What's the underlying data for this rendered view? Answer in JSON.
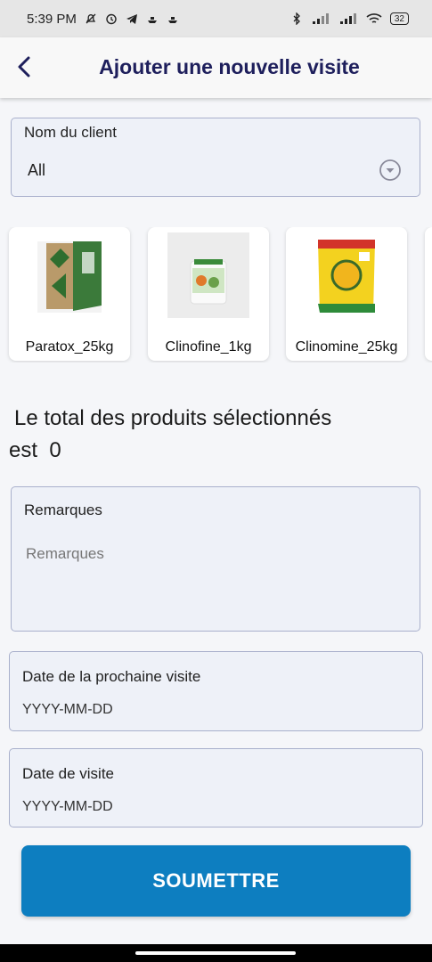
{
  "status": {
    "time": "5:39 PM",
    "battery": "32"
  },
  "appbar": {
    "title": "Ajouter une nouvelle visite"
  },
  "client": {
    "label": "Nom du client",
    "value": "All"
  },
  "products": [
    {
      "name": "Paratox_25kg",
      "icon": "green-box-product-image"
    },
    {
      "name": "Clinofine_1kg",
      "icon": "white-jar-product-image"
    },
    {
      "name": "Clinomine_25kg",
      "icon": "yellow-bag-product-image"
    }
  ],
  "total": {
    "line1": "Le total des produits sélectionnés",
    "line2": "est",
    "value": "0"
  },
  "remarks": {
    "label": "Remarques",
    "placeholder": "Remarques"
  },
  "next_visit": {
    "label": "Date de la prochaine visite",
    "placeholder": "YYYY-MM-DD"
  },
  "visit_date": {
    "label": "Date de visite",
    "placeholder": "YYYY-MM-DD"
  },
  "submit_label": "SOUMETTRE",
  "colors": {
    "title": "#1e1f5c",
    "submit": "#0d7ec0",
    "field_bg": "#eef1f8",
    "field_border": "#a9b0cc"
  }
}
